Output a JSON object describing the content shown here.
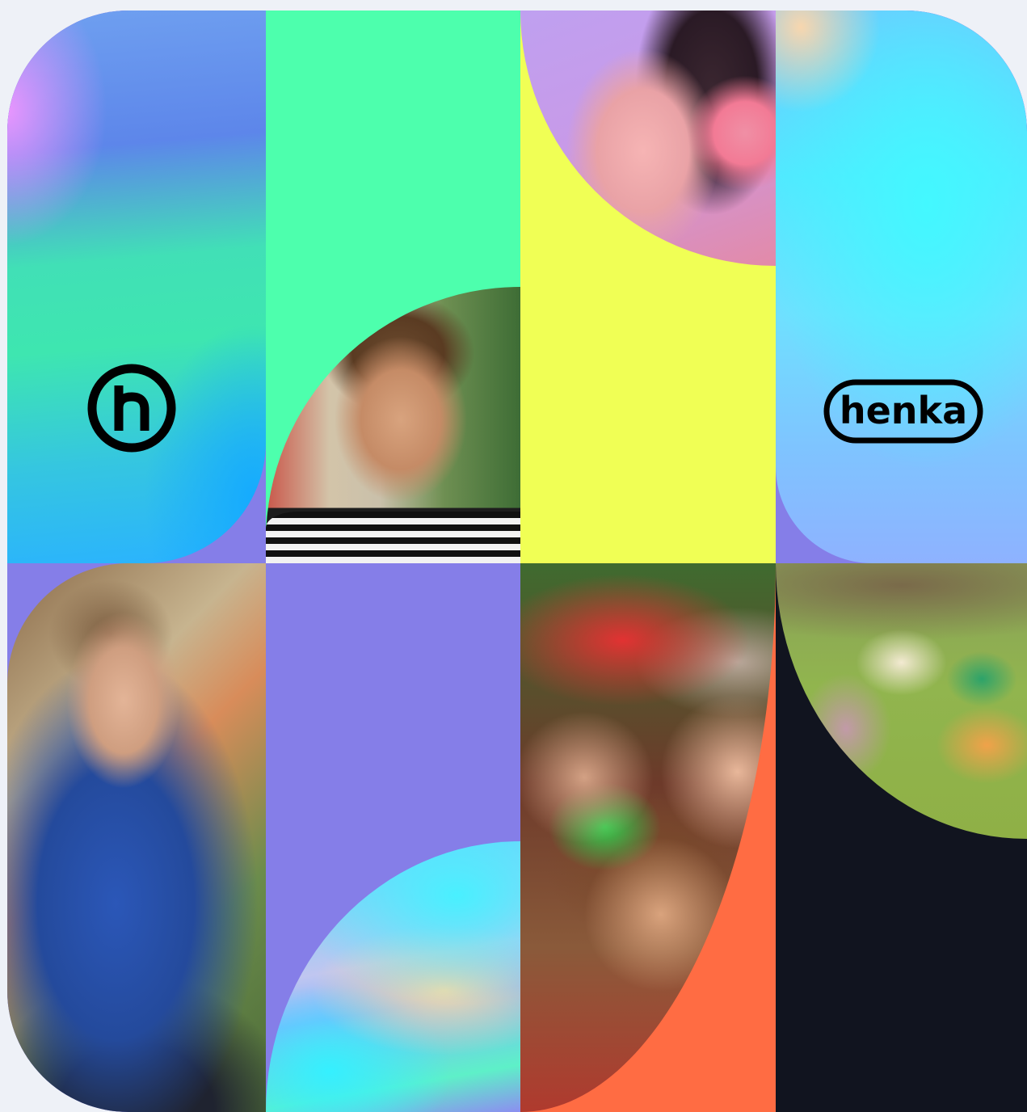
{
  "brand": {
    "monogram": "h",
    "wordmark": "henka"
  },
  "colors": {
    "page_background": "#eef1f7",
    "mint": "#4dffad",
    "yellow": "#f0ff55",
    "purple": "#857ee8",
    "orange": "#ff6c43",
    "navy": "#11141f"
  },
  "tiles": [
    {
      "name": "gradient-logo-tile",
      "icon": "henka-monogram-logo"
    },
    {
      "name": "laughing-boy-photo-tile"
    },
    {
      "name": "woman-headphones-photo-tile"
    },
    {
      "name": "wordmark-tile",
      "icon": "henka-wordmark-logo"
    },
    {
      "name": "meditating-boy-photo-tile"
    },
    {
      "name": "holographic-gradient-tile"
    },
    {
      "name": "friends-lying-on-grass-photo-tile"
    },
    {
      "name": "kids-sitting-on-grass-photo-tile"
    }
  ]
}
